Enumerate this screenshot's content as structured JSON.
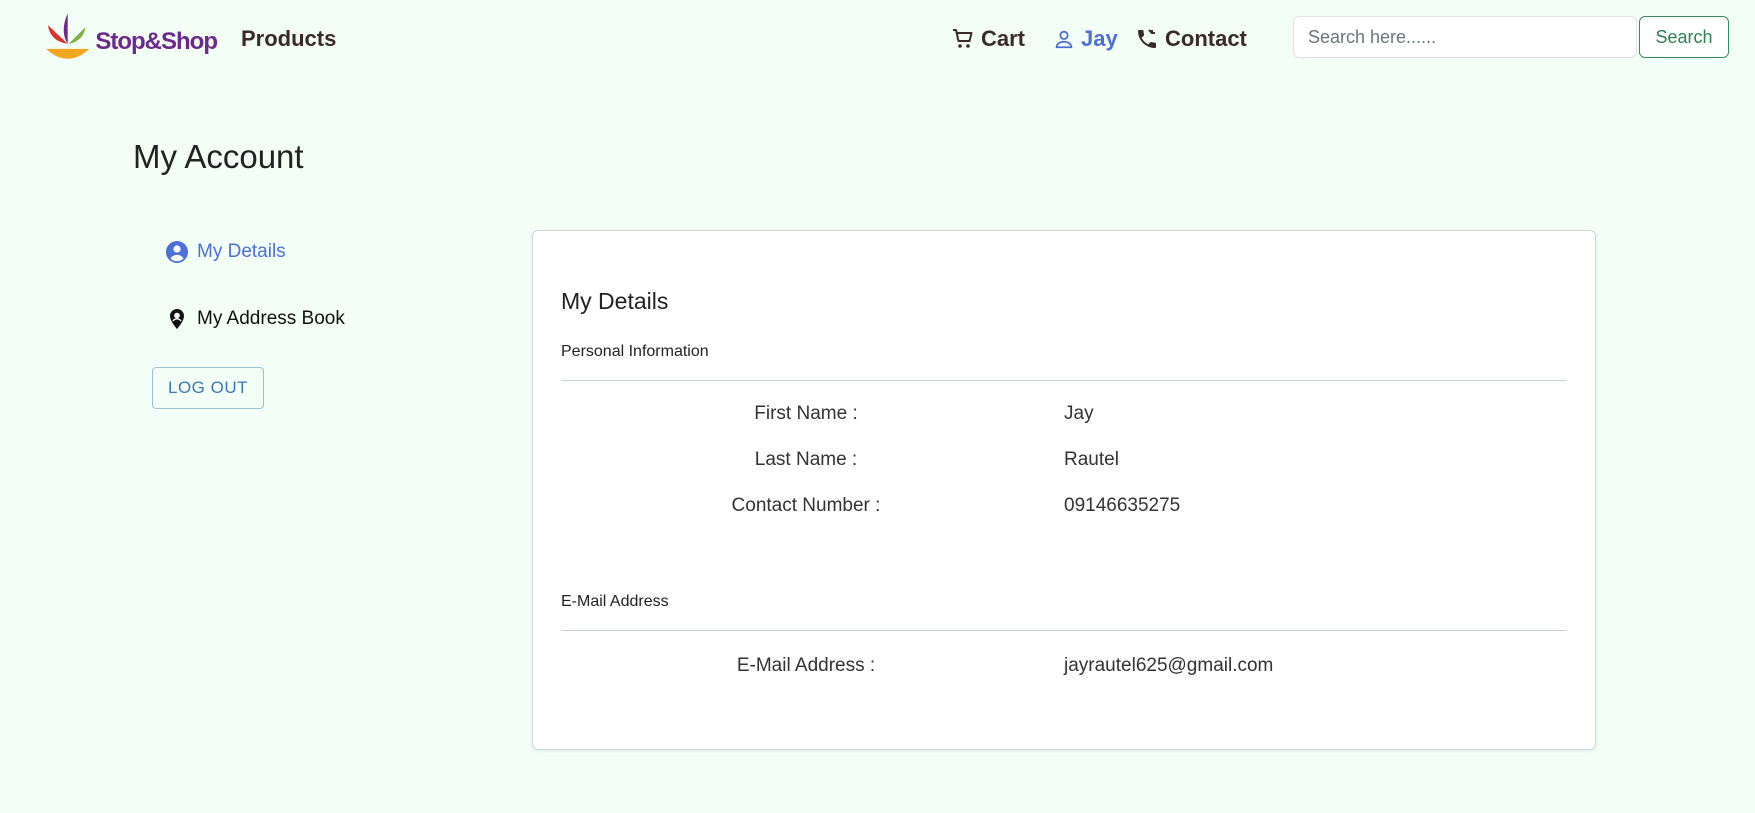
{
  "brand": {
    "name_part1": "Stop&",
    "name_part2": "Shop",
    "trademark": "·",
    "color_purple": "#6b2a8c"
  },
  "nav": {
    "products": "Products",
    "cart": "Cart",
    "user": "Jay",
    "contact": "Contact",
    "accent_color": "#4d6fd6"
  },
  "search": {
    "placeholder": "Search here......",
    "button": "Search"
  },
  "page": {
    "title": "My Account"
  },
  "sidebar": {
    "items": [
      {
        "label": "My Details",
        "icon": "account-circle-icon",
        "active": true
      },
      {
        "label": "My Address Book",
        "icon": "location-pin-icon",
        "active": false
      }
    ],
    "logout": "LOG OUT"
  },
  "details": {
    "title": "My Details",
    "personal_section": "Personal Information",
    "rows": [
      {
        "label": "First Name :",
        "value": "Jay"
      },
      {
        "label": "Last Name :",
        "value": "Rautel"
      },
      {
        "label": "Contact Number :",
        "value": "09146635275"
      }
    ],
    "email_section": "E-Mail Address",
    "email_row": {
      "label": "E-Mail Address :",
      "value": "jayrautel625@gmail.com"
    }
  }
}
